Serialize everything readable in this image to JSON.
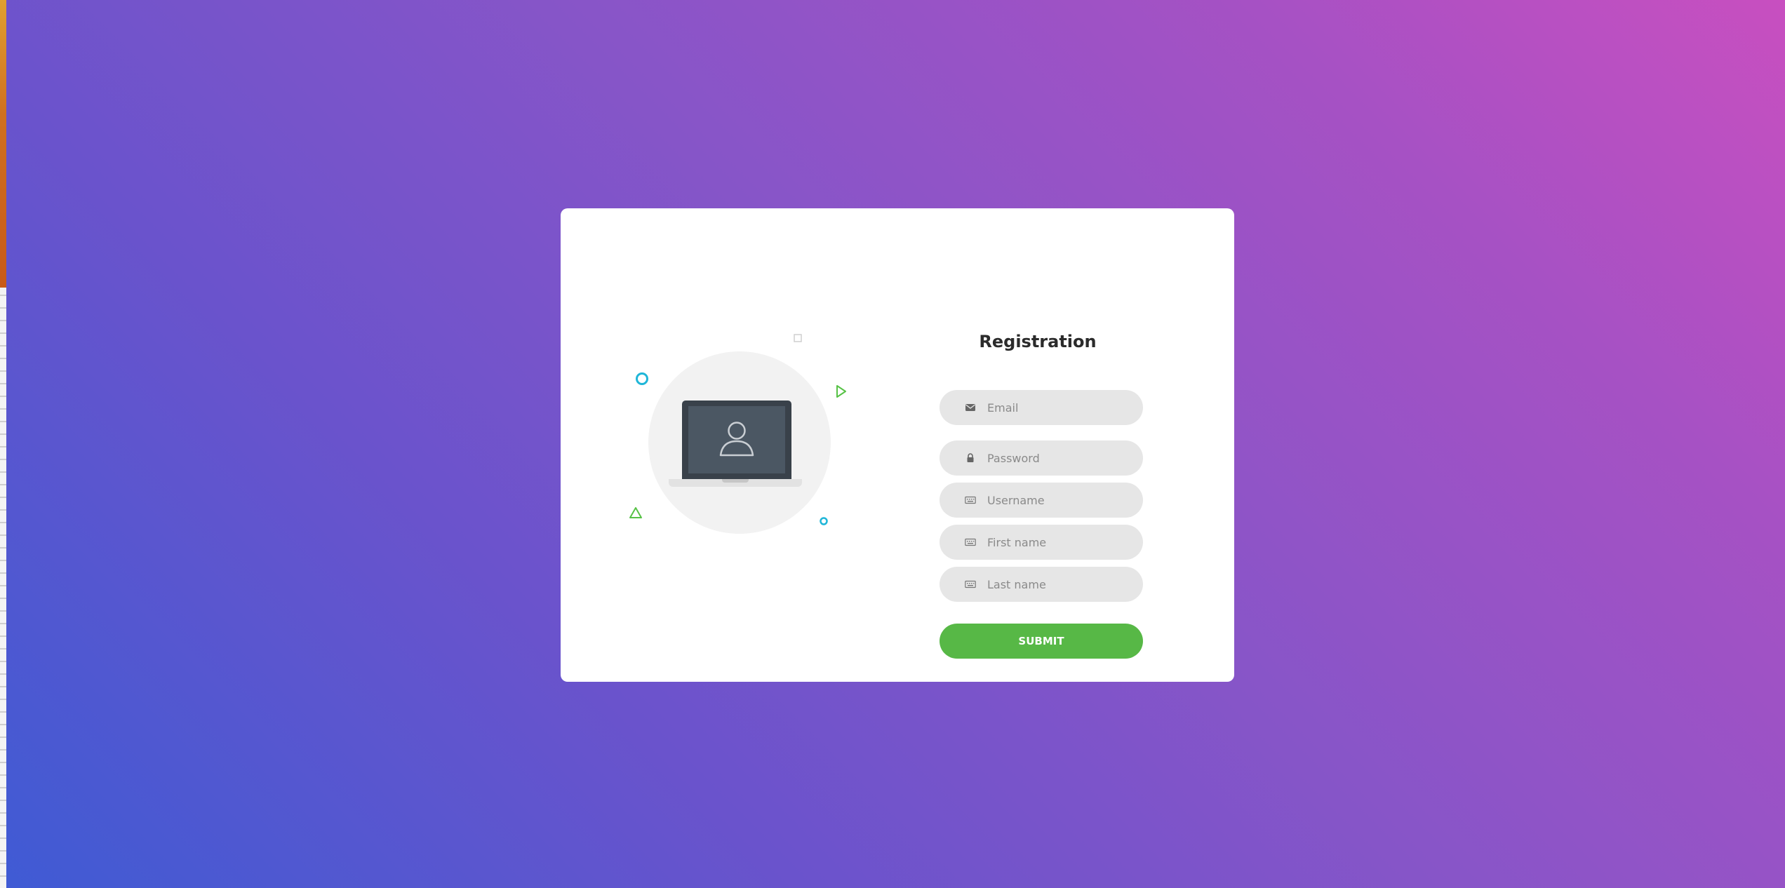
{
  "form": {
    "title": "Registration",
    "fields": [
      {
        "name": "email",
        "placeholder": "Email",
        "icon": "envelope-icon"
      },
      {
        "name": "password",
        "placeholder": "Password",
        "icon": "lock-icon"
      },
      {
        "name": "username",
        "placeholder": "Username",
        "icon": "keyboard-icon"
      },
      {
        "name": "first_name",
        "placeholder": "First name",
        "icon": "keyboard-icon"
      },
      {
        "name": "last_name",
        "placeholder": "Last name",
        "icon": "keyboard-icon"
      }
    ],
    "submit_label": "SUBMIT"
  },
  "illustration": {
    "icons": [
      "laptop-icon",
      "user-icon"
    ]
  },
  "colors": {
    "accent": "#57b846",
    "field_bg": "#e6e6e6",
    "card_bg": "#ffffff",
    "deco_cyan": "#1fb6d8",
    "deco_green": "#57c246",
    "gradient_start": "#3f5bd4",
    "gradient_end": "#c84fc0"
  }
}
